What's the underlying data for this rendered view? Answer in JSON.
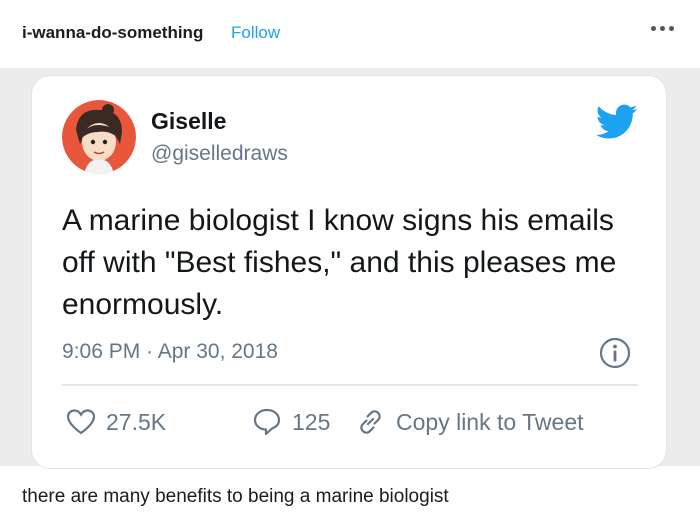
{
  "post": {
    "author": "i-wanna-do-something",
    "follow_label": "Follow",
    "more_icon": "ellipsis-icon",
    "caption": "there are many benefits to being a marine biologist"
  },
  "tweet": {
    "name": "Giselle",
    "handle": "@giselledraws",
    "text": "A marine biologist I know signs his emails off with \"Best fishes,\" and this pleases me enormously.",
    "timestamp": "9:06 PM · Apr 30, 2018",
    "likes": "27.5K",
    "replies": "125",
    "copy_link_label": "Copy link to Tweet",
    "colors": {
      "brand": "#1da1f2",
      "muted": "#657786",
      "text": "#14171a"
    }
  }
}
